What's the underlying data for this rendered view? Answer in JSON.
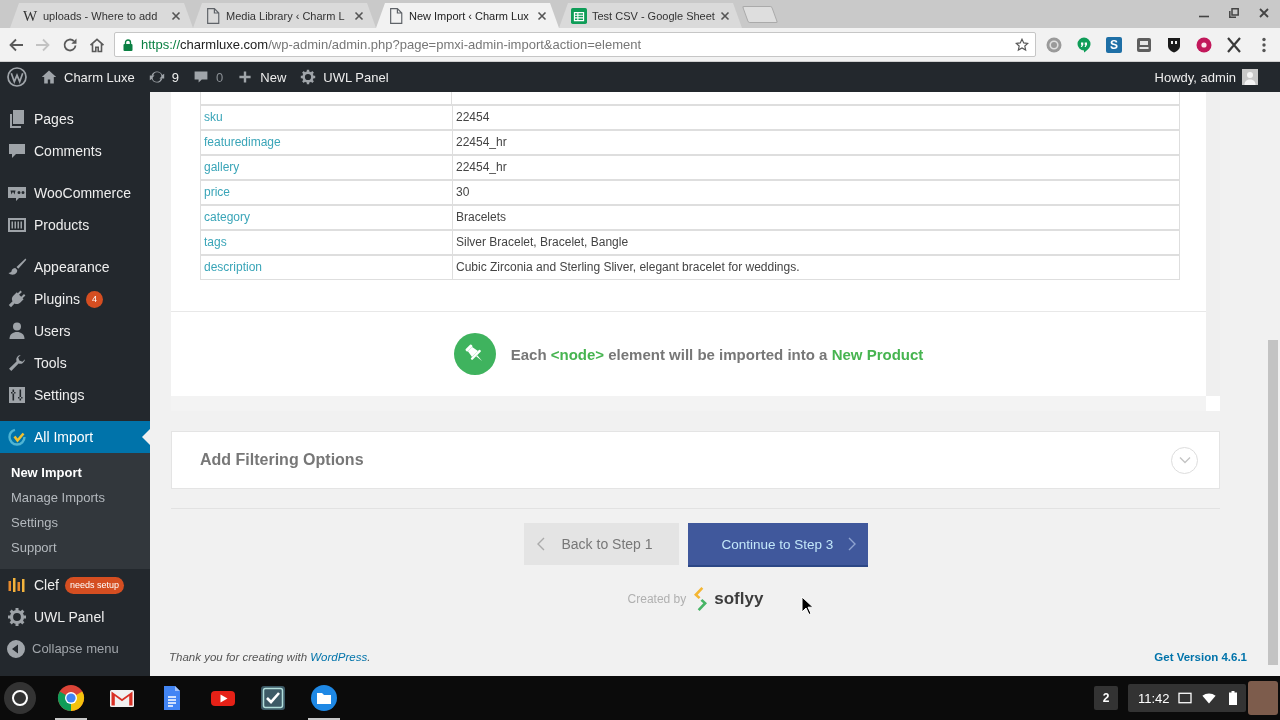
{
  "browser": {
    "tabs": [
      {
        "kind": "letter",
        "glyph": "W",
        "title": "uploads - Where to add",
        "selected": false
      },
      {
        "kind": "page",
        "title": "Media Library ‹ Charm L",
        "selected": false
      },
      {
        "kind": "page",
        "title": "New Import ‹ Charm Lux",
        "selected": true
      },
      {
        "kind": "sheet",
        "title": "Test CSV - Google Sheet",
        "selected": false
      }
    ],
    "nav_buttons": [
      {
        "kind": "back",
        "disabled": false
      },
      {
        "kind": "forward",
        "disabled": true
      },
      {
        "kind": "reload",
        "disabled": false
      },
      {
        "kind": "home",
        "disabled": false
      }
    ],
    "url": {
      "scheme": "https://",
      "host": "charmluxe.com",
      "path": "/wp-admin/admin.php?page=pmxi-admin-import&action=element"
    },
    "extension_letter": "S"
  },
  "admin_bar": {
    "items": [
      {
        "kind": "logo"
      },
      {
        "kind": "site",
        "label": "Charm Luxe"
      },
      {
        "kind": "updates",
        "label": "9"
      },
      {
        "kind": "comments",
        "label": "0"
      },
      {
        "kind": "new",
        "label": "New"
      },
      {
        "kind": "panel",
        "label": "UWL Panel"
      }
    ],
    "greeting": "Howdy, admin"
  },
  "sidebar": {
    "groups": [
      {
        "items": [
          {
            "kind": "pages",
            "label": "Pages",
            "selected": false
          },
          {
            "kind": "comments",
            "label": "Comments",
            "selected": false
          }
        ]
      },
      {
        "items": [
          {
            "kind": "woocommerce",
            "label": "WooCommerce",
            "selected": false
          },
          {
            "kind": "products",
            "label": "Products",
            "selected": false
          }
        ]
      },
      {
        "items": [
          {
            "kind": "appearance",
            "label": "Appearance",
            "selected": false
          },
          {
            "kind": "plugins",
            "label": "Plugins",
            "badge": "4",
            "selected": false
          },
          {
            "kind": "users",
            "label": "Users",
            "selected": false
          },
          {
            "kind": "tools",
            "label": "Tools",
            "selected": false
          },
          {
            "kind": "settings",
            "label": "Settings",
            "selected": false
          }
        ]
      },
      {
        "items": [
          {
            "kind": "import",
            "label": "All Import",
            "selected": true,
            "submenu": [
              {
                "label": "New Import",
                "selected": true
              },
              {
                "label": "Manage Imports",
                "selected": false
              },
              {
                "label": "Settings",
                "selected": false
              },
              {
                "label": "Support",
                "selected": false
              }
            ]
          },
          {
            "kind": "clef",
            "label": "Clef",
            "badge": "needs setup",
            "selected": false
          },
          {
            "kind": "panel",
            "label": "UWL Panel",
            "selected": false
          }
        ]
      }
    ],
    "collapse_label": "Collapse menu"
  },
  "import_table": {
    "rows": [
      {
        "field": "sku",
        "value": "22454"
      },
      {
        "field": "featuredimage",
        "value": "22454_hr"
      },
      {
        "field": "gallery",
        "value": "22454_hr"
      },
      {
        "field": "price",
        "value": "30"
      },
      {
        "field": "category",
        "value": "Bracelets"
      },
      {
        "field": "tags",
        "value": "Silver Bracelet, Bracelet, Bangle"
      },
      {
        "field": "description",
        "value": "Cubic Zirconia and Sterling Sliver, elegant bracelet for weddings."
      }
    ]
  },
  "notice": {
    "parts": [
      {
        "text": "Each ",
        "highlight": false
      },
      {
        "text": "<node>",
        "highlight": true
      },
      {
        "text": " element will be imported into a ",
        "highlight": false
      },
      {
        "text": "New Product",
        "highlight": true
      }
    ]
  },
  "filter_section": {
    "title": "Add Filtering Options",
    "expanded": false
  },
  "step_buttons": [
    {
      "kind": "back",
      "label": "Back to Step 1"
    },
    {
      "kind": "next",
      "label": "Continue to Step 3"
    }
  ],
  "credit": {
    "prefix": "Created by",
    "brand": "soflyy"
  },
  "footer": {
    "thanks": "Thank you for creating with ",
    "link": "WordPress",
    "after": ".",
    "version": "Get Version 4.6.1"
  },
  "taskbar": {
    "apps": [
      {
        "kind": "chrome",
        "running": true
      },
      {
        "kind": "gmail",
        "running": false
      },
      {
        "kind": "docs",
        "running": false
      },
      {
        "kind": "youtube",
        "running": false
      },
      {
        "kind": "tasks",
        "running": false
      },
      {
        "kind": "files",
        "running": true
      }
    ],
    "notifications": "2",
    "time": "11:42"
  }
}
